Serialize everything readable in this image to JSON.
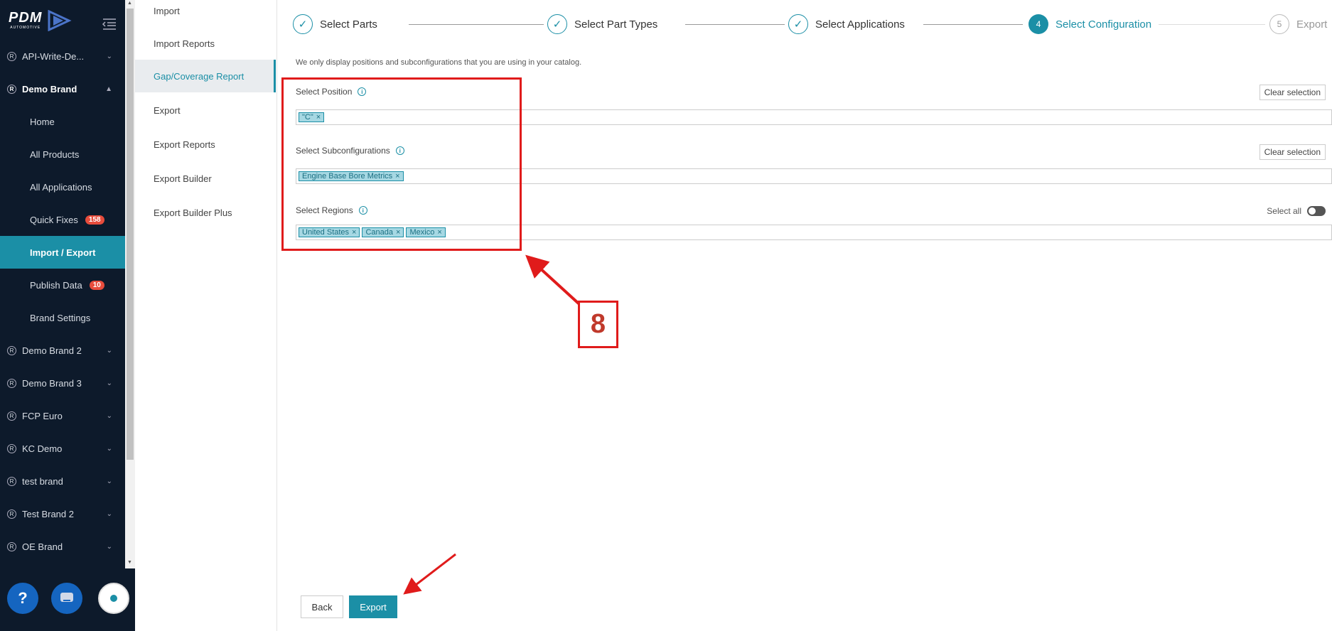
{
  "logo": {
    "text": "PDM",
    "subtext": "AUTOMOTIVE"
  },
  "sidebar": {
    "items": [
      {
        "label": "API-Write-De...",
        "type": "brand"
      },
      {
        "label": "Demo Brand",
        "type": "brand-open"
      },
      {
        "label": "Home",
        "type": "sub"
      },
      {
        "label": "All Products",
        "type": "sub"
      },
      {
        "label": "All Applications",
        "type": "sub"
      },
      {
        "label": "Quick Fixes",
        "type": "sub",
        "badge": "158"
      },
      {
        "label": "Import / Export",
        "type": "sub-active"
      },
      {
        "label": "Publish Data",
        "type": "sub",
        "badge": "10"
      },
      {
        "label": "Brand Settings",
        "type": "sub"
      },
      {
        "label": "Demo Brand 2",
        "type": "brand"
      },
      {
        "label": "Demo Brand 3",
        "type": "brand"
      },
      {
        "label": "FCP Euro",
        "type": "brand"
      },
      {
        "label": "KC Demo",
        "type": "brand"
      },
      {
        "label": "test brand",
        "type": "brand"
      },
      {
        "label": "Test Brand 2",
        "type": "brand"
      },
      {
        "label": "OE Brand",
        "type": "brand"
      }
    ]
  },
  "submenu": {
    "items": [
      "Import",
      "Import Reports",
      "Gap/Coverage Report",
      "Export",
      "Export Reports",
      "Export Builder",
      "Export Builder Plus"
    ],
    "active": "Gap/Coverage Report"
  },
  "stepper": {
    "steps": [
      {
        "label": "Select Parts",
        "state": "done"
      },
      {
        "label": "Select Part Types",
        "state": "done"
      },
      {
        "label": "Select Applications",
        "state": "done"
      },
      {
        "label": "Select Configuration",
        "state": "current",
        "num": "4"
      },
      {
        "label": "Export",
        "state": "future",
        "num": "5"
      }
    ]
  },
  "main": {
    "info_text": "We only display positions and subconfigurations that you are using in your catalog.",
    "position": {
      "label": "Select Position",
      "clear": "Clear selection",
      "tags": [
        "\"C\""
      ]
    },
    "subconfig": {
      "label": "Select Subconfigurations",
      "clear": "Clear selection",
      "tags": [
        "Engine Base Bore Metrics"
      ]
    },
    "regions": {
      "label": "Select Regions",
      "select_all": "Select all",
      "tags": [
        "United States",
        "Canada",
        "Mexico"
      ]
    }
  },
  "annotation": {
    "number": "8"
  },
  "buttons": {
    "back": "Back",
    "export": "Export"
  },
  "colors": {
    "accent": "#1b8fa6",
    "sidebar_bg": "#0d1a2b",
    "annotation": "#e01b1b"
  }
}
